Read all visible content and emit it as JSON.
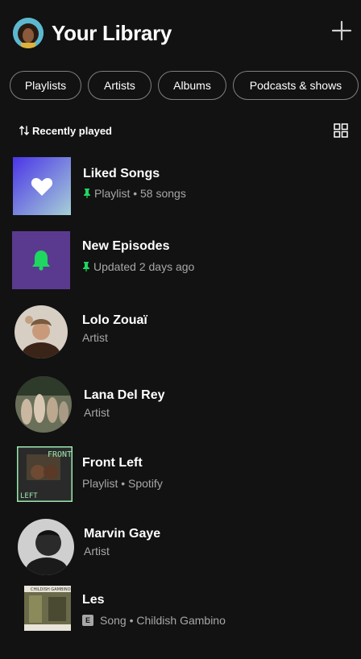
{
  "header": {
    "title": "Your Library"
  },
  "filters": [
    "Playlists",
    "Artists",
    "Albums",
    "Podcasts & shows"
  ],
  "sort": {
    "label": "Recently played"
  },
  "items": [
    {
      "title": "Liked Songs",
      "subtitle": "Playlist • 58 songs",
      "pinned": true,
      "shape": "square",
      "colors": [
        "#4b35e8",
        "#a6cfd6"
      ]
    },
    {
      "title": "New Episodes",
      "subtitle": "Updated 2 days ago",
      "pinned": true,
      "shape": "square",
      "colors": [
        "#5a3a8f"
      ]
    },
    {
      "title": "Lolo Zouaï",
      "subtitle": "Artist",
      "shape": "circle"
    },
    {
      "title": "Lana Del Rey",
      "subtitle": "Artist",
      "shape": "circle"
    },
    {
      "title": "Front Left",
      "subtitle": "Playlist • Spotify",
      "shape": "square",
      "cover_text": "FRONT LEFT"
    },
    {
      "title": "Marvin Gaye",
      "subtitle": "Artist",
      "shape": "circle"
    },
    {
      "title": "Les",
      "subtitle": "Song • Childish Gambino",
      "explicit_badge": "E",
      "shape": "square",
      "cover_text": "CHILDISH GAMBINO"
    }
  ],
  "colors": {
    "background": "#121212",
    "accent_green": "#1ed760",
    "subtext": "#a7a7a7"
  }
}
